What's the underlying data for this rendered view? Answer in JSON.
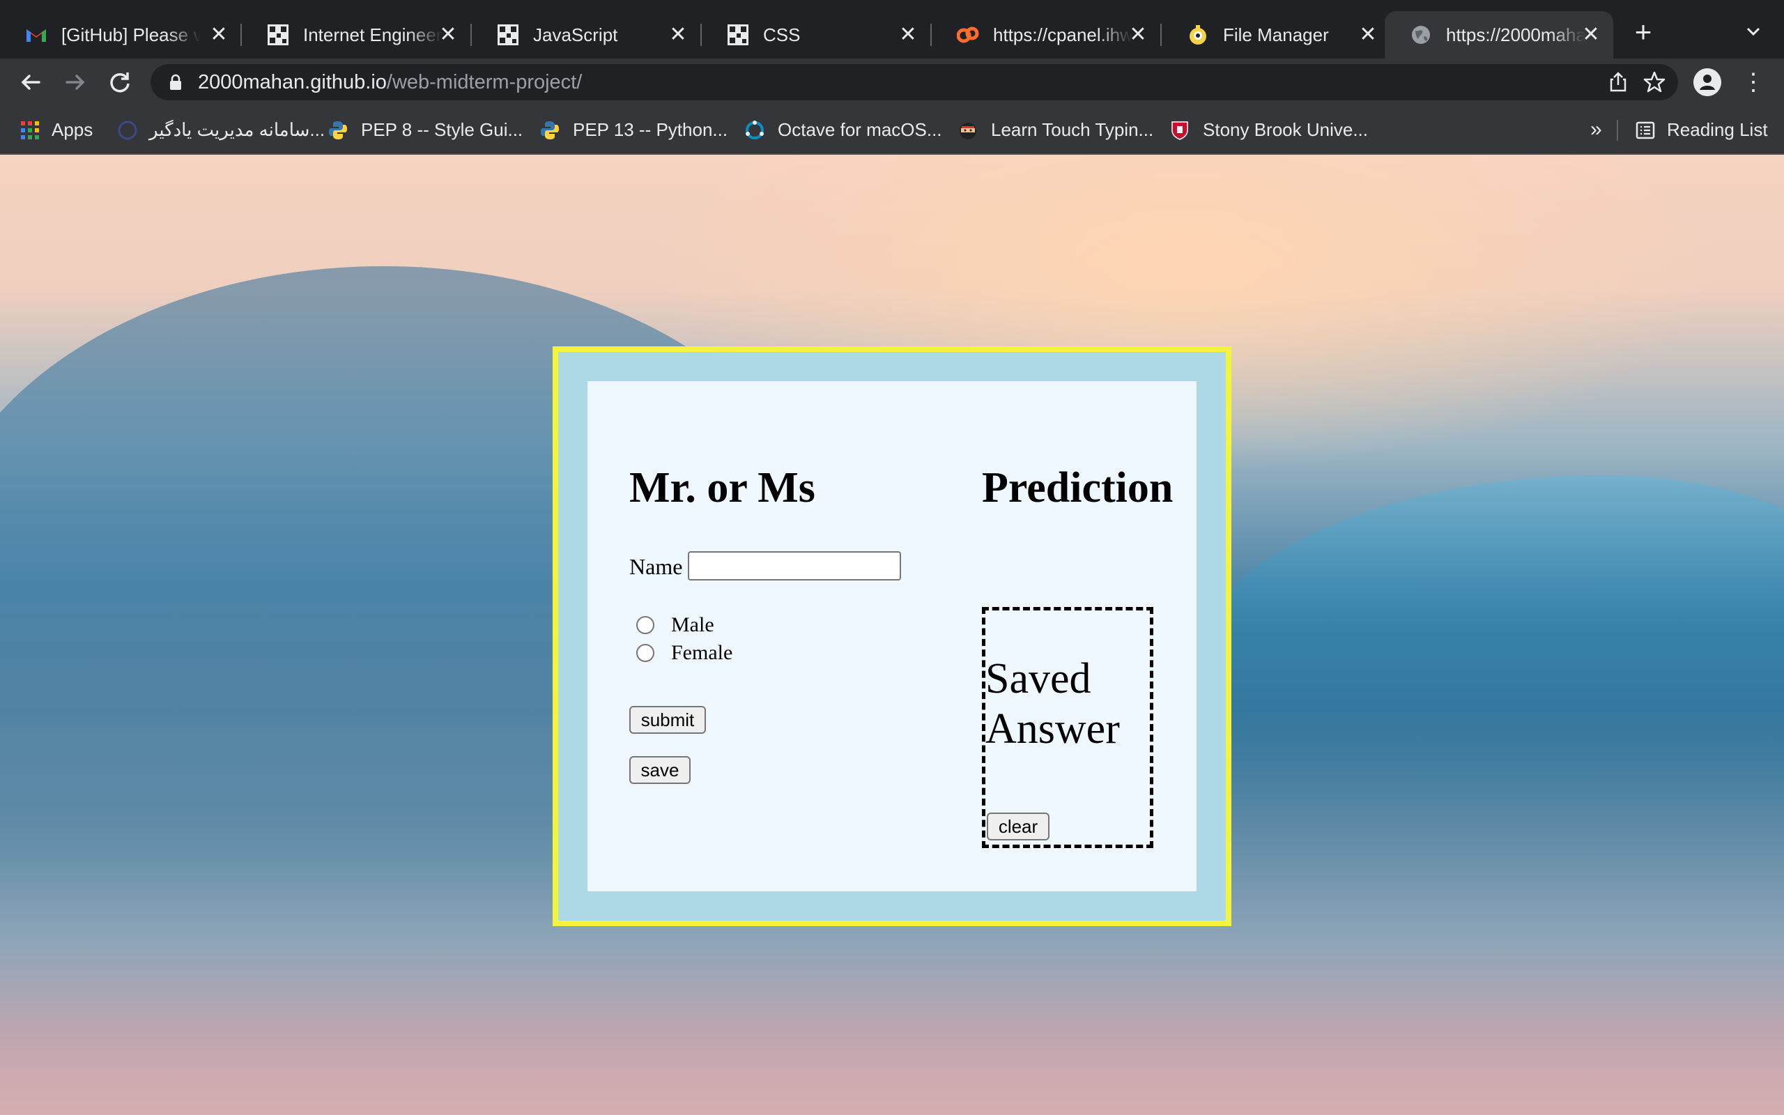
{
  "browser": {
    "tabs": [
      {
        "title": "[GitHub] Please v",
        "icon": "gmail-icon"
      },
      {
        "title": "Internet Engineeri",
        "icon": "qr-icon"
      },
      {
        "title": "JavaScript",
        "icon": "qr-icon"
      },
      {
        "title": "CSS",
        "icon": "qr-icon"
      },
      {
        "title": "https://cpanel.ihw",
        "icon": "cpanel-icon"
      },
      {
        "title": "File Manager",
        "icon": "file-manager-icon"
      },
      {
        "title": "https://2000maha",
        "icon": "globe-icon",
        "active": true
      }
    ],
    "new_tab": "+",
    "tab_close": "✕",
    "url_host": "2000mahan.github.io",
    "url_path": "/web-midterm-project/",
    "bookmarks": [
      {
        "label": "Apps",
        "icon": "apps-grid-icon"
      },
      {
        "label": "سامانه مدیریت یادگیر...",
        "icon": "site-icon"
      },
      {
        "label": "PEP 8 -- Style Gui...",
        "icon": "python-icon"
      },
      {
        "label": "PEP 13 -- Python...",
        "icon": "python-icon"
      },
      {
        "label": "Octave for macOS...",
        "icon": "octave-icon"
      },
      {
        "label": "Learn Touch Typin...",
        "icon": "ninja-icon"
      },
      {
        "label": "Stony Brook Unive...",
        "icon": "shield-icon"
      }
    ],
    "overflow": "»",
    "reading_list": "Reading List"
  },
  "page": {
    "left_title": "Mr. or Ms",
    "right_title": "Prediction",
    "name_label": "Name",
    "name_value": "",
    "genders": [
      "Male",
      "Female"
    ],
    "submit_label": "submit",
    "save_label": "save",
    "saved_title": "Saved Answer",
    "clear_label": "clear"
  },
  "colors": {
    "frame_border": "#f4f43a",
    "frame_bg": "#add8e6",
    "card_bg": "#f0f8ff"
  }
}
